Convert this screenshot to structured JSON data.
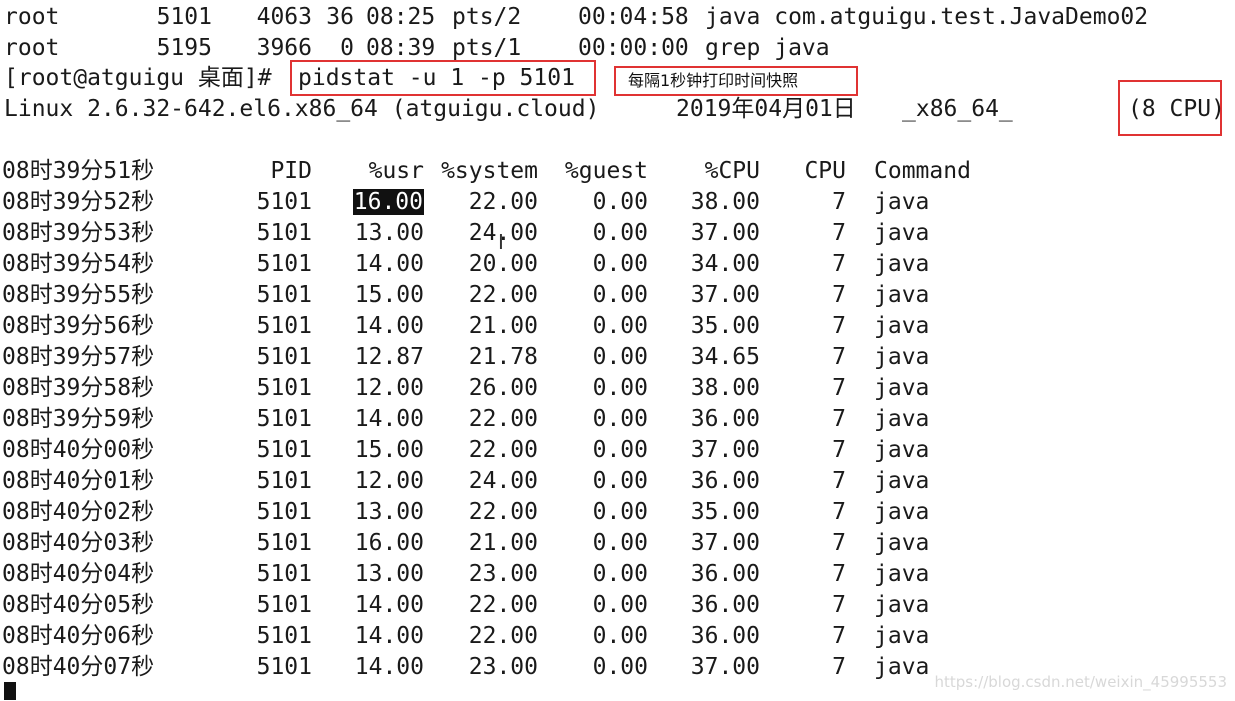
{
  "ps_lines": [
    {
      "user": "root",
      "pid": "5101",
      "mem": "4063",
      "cpu": "36",
      "start": "08:25",
      "tty": "pts/2",
      "time": "00:04:58",
      "cmd": "java com.atguigu.test.JavaDemo02"
    },
    {
      "user": "root",
      "pid": "5195",
      "mem": "3966",
      "cpu": "0",
      "start": "08:39",
      "tty": "pts/1",
      "time": "00:00:00",
      "cmd": "grep java"
    }
  ],
  "prompt": "[root@atguigu 桌面]#",
  "command": "pidstat -u 1 -p 5101",
  "annotation": "每隔1秒钟打印时间快照",
  "sysinfo": {
    "kernel": "Linux 2.6.32-642.el6.x86_64 (atguigu.cloud)",
    "date": "2019年04月01日",
    "arch": "_x86_64_",
    "cpus": "(8 CPU)"
  },
  "table": {
    "header": {
      "time": "08时39分51秒",
      "pid": "PID",
      "usr": "%usr",
      "system": "%system",
      "guest": "%guest",
      "cpu_pct": "%CPU",
      "cpu": "CPU",
      "command": "Command"
    },
    "rows": [
      {
        "time": "08时39分52秒",
        "pid": "5101",
        "usr": "16.00",
        "system": "22.00",
        "guest": "0.00",
        "cpu_pct": "38.00",
        "cpu": "7",
        "command": "java"
      },
      {
        "time": "08时39分53秒",
        "pid": "5101",
        "usr": "13.00",
        "system": "24.00",
        "guest": "0.00",
        "cpu_pct": "37.00",
        "cpu": "7",
        "command": "java"
      },
      {
        "time": "08时39分54秒",
        "pid": "5101",
        "usr": "14.00",
        "system": "20.00",
        "guest": "0.00",
        "cpu_pct": "34.00",
        "cpu": "7",
        "command": "java"
      },
      {
        "time": "08时39分55秒",
        "pid": "5101",
        "usr": "15.00",
        "system": "22.00",
        "guest": "0.00",
        "cpu_pct": "37.00",
        "cpu": "7",
        "command": "java"
      },
      {
        "time": "08时39分56秒",
        "pid": "5101",
        "usr": "14.00",
        "system": "21.00",
        "guest": "0.00",
        "cpu_pct": "35.00",
        "cpu": "7",
        "command": "java"
      },
      {
        "time": "08时39分57秒",
        "pid": "5101",
        "usr": "12.87",
        "system": "21.78",
        "guest": "0.00",
        "cpu_pct": "34.65",
        "cpu": "7",
        "command": "java"
      },
      {
        "time": "08时39分58秒",
        "pid": "5101",
        "usr": "12.00",
        "system": "26.00",
        "guest": "0.00",
        "cpu_pct": "38.00",
        "cpu": "7",
        "command": "java"
      },
      {
        "time": "08时39分59秒",
        "pid": "5101",
        "usr": "14.00",
        "system": "22.00",
        "guest": "0.00",
        "cpu_pct": "36.00",
        "cpu": "7",
        "command": "java"
      },
      {
        "time": "08时40分00秒",
        "pid": "5101",
        "usr": "15.00",
        "system": "22.00",
        "guest": "0.00",
        "cpu_pct": "37.00",
        "cpu": "7",
        "command": "java"
      },
      {
        "time": "08时40分01秒",
        "pid": "5101",
        "usr": "12.00",
        "system": "24.00",
        "guest": "0.00",
        "cpu_pct": "36.00",
        "cpu": "7",
        "command": "java"
      },
      {
        "time": "08时40分02秒",
        "pid": "5101",
        "usr": "13.00",
        "system": "22.00",
        "guest": "0.00",
        "cpu_pct": "35.00",
        "cpu": "7",
        "command": "java"
      },
      {
        "time": "08时40分03秒",
        "pid": "5101",
        "usr": "16.00",
        "system": "21.00",
        "guest": "0.00",
        "cpu_pct": "37.00",
        "cpu": "7",
        "command": "java"
      },
      {
        "time": "08时40分04秒",
        "pid": "5101",
        "usr": "13.00",
        "system": "23.00",
        "guest": "0.00",
        "cpu_pct": "36.00",
        "cpu": "7",
        "command": "java"
      },
      {
        "time": "08时40分05秒",
        "pid": "5101",
        "usr": "14.00",
        "system": "22.00",
        "guest": "0.00",
        "cpu_pct": "36.00",
        "cpu": "7",
        "command": "java"
      },
      {
        "time": "08时40分06秒",
        "pid": "5101",
        "usr": "14.00",
        "system": "22.00",
        "guest": "0.00",
        "cpu_pct": "36.00",
        "cpu": "7",
        "command": "java"
      },
      {
        "time": "08时40分07秒",
        "pid": "5101",
        "usr": "14.00",
        "system": "23.00",
        "guest": "0.00",
        "cpu_pct": "37.00",
        "cpu": "7",
        "command": "java"
      }
    ]
  },
  "watermark": "https://blog.csdn.net/weixin_45995553",
  "colors": {
    "highlight_box": "#e03333",
    "text": "#1a1a1a"
  }
}
